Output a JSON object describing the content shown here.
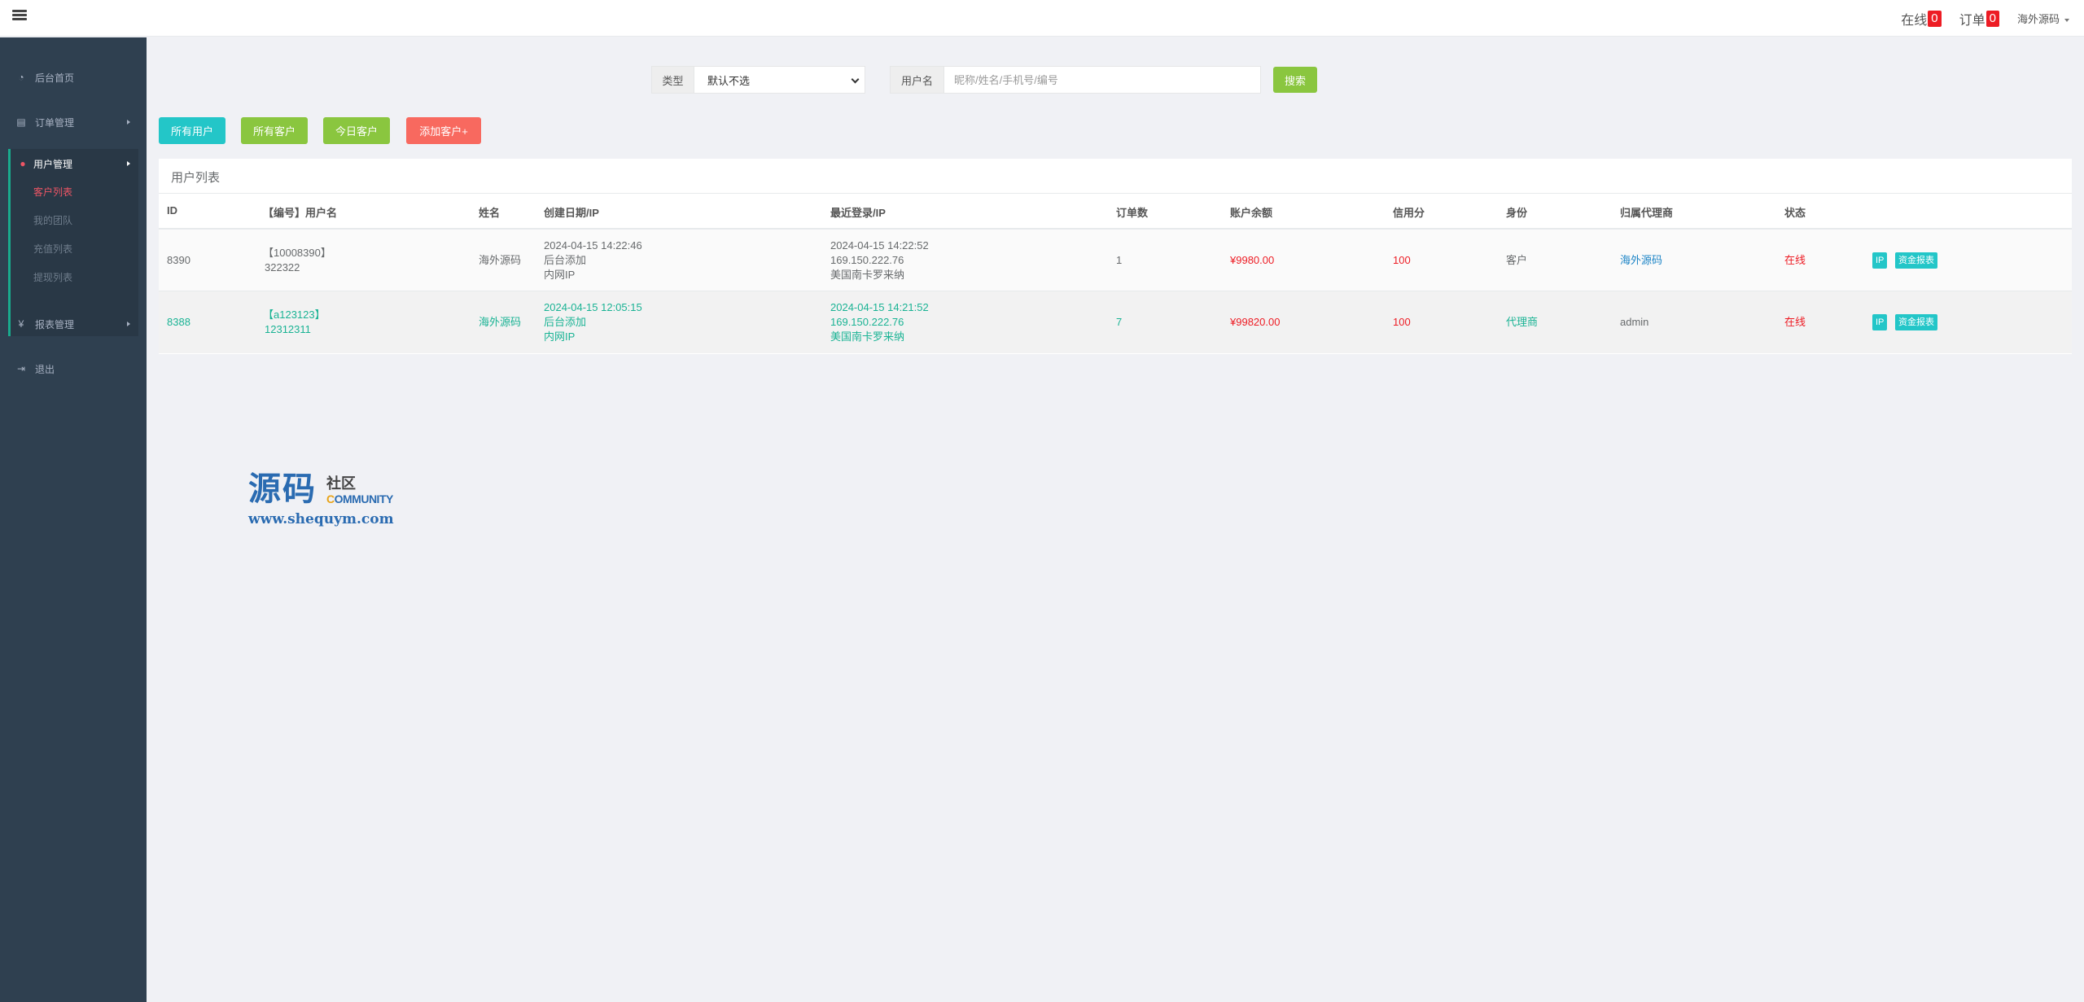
{
  "topbar": {
    "online_label": "在线",
    "online_count": "0",
    "orders_label": "订单",
    "orders_count": "0",
    "user_name": "海外源码"
  },
  "sidebar": {
    "items": [
      {
        "label": "后台首页",
        "icon": "dashboard-icon"
      },
      {
        "label": "订单管理",
        "icon": "orders-icon"
      },
      {
        "label": "用户管理",
        "icon": "user-icon"
      },
      {
        "label": "报表管理",
        "icon": "yen-icon"
      },
      {
        "label": "退出",
        "icon": "logout-icon"
      }
    ],
    "sub_items": [
      "客户列表",
      "我的团队",
      "充值列表",
      "提现列表"
    ]
  },
  "search": {
    "type_label": "类型",
    "type_selected": "默认不选",
    "username_label": "用户名",
    "username_placeholder": "昵称/姓名/手机号/编号",
    "search_button": "搜索"
  },
  "filters": {
    "all_users": "所有用户",
    "all_customers": "所有客户",
    "today_customers": "今日客户",
    "add_customer": "添加客户+"
  },
  "panel": {
    "title": "用户列表",
    "headers": [
      "ID",
      "【编号】用户名",
      "姓名",
      "创建日期/IP",
      "最近登录/IP",
      "订单数",
      "账户余额",
      "信用分",
      "身份",
      "归属代理商",
      "状态"
    ],
    "rows": [
      {
        "id": "8390",
        "code": "【10008390】",
        "username": "322322",
        "name": "海外源码",
        "created_date": "2024-04-15 14:22:46",
        "created_src": "后台添加",
        "created_ip": "内网IP",
        "login_date": "2024-04-15 14:22:52",
        "login_ip": "169.150.222.76",
        "login_loc": "美国南卡罗来纳",
        "orders": "1",
        "balance": "¥9980.00",
        "credit": "100",
        "role": "客户",
        "agent": "海外源码",
        "status": "在线",
        "btn_ip": "IP",
        "btn_report": "资金报表"
      },
      {
        "id": "8388",
        "code": "【a123123】",
        "username": "12312311",
        "name": "海外源码",
        "created_date": "2024-04-15 12:05:15",
        "created_src": "后台添加",
        "created_ip": "内网IP",
        "login_date": "2024-04-15 14:21:52",
        "login_ip": "169.150.222.76",
        "login_loc": "美国南卡罗来纳",
        "orders": "7",
        "balance": "¥99820.00",
        "credit": "100",
        "role": "代理商",
        "agent": "admin",
        "status": "在线",
        "btn_ip": "IP",
        "btn_report": "资金报表"
      }
    ]
  },
  "watermark": {
    "big": "源码",
    "small": "社区",
    "community_first": "C",
    "community_rest": "OMMUNITY",
    "url": "www.shequym.com"
  },
  "colors": {
    "sidebar_bg": "#2f4050",
    "accent_teal": "#23c6c8",
    "accent_green": "#8ac63f",
    "accent_red": "#f8695f",
    "status_red": "#ed1c24"
  }
}
